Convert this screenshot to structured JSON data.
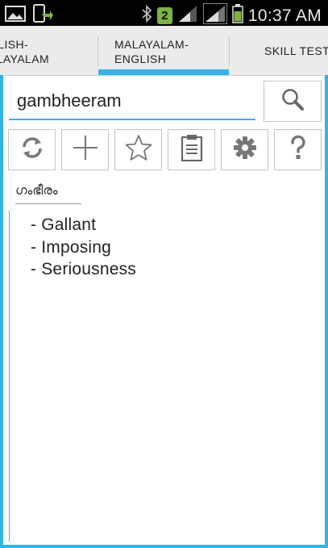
{
  "status_bar": {
    "time": "10:37 AM",
    "notification_count": "2",
    "icons": [
      "gallery-icon",
      "phone-transfer-icon",
      "bluetooth-icon",
      "signal-icon",
      "signal-icon",
      "battery-icon"
    ]
  },
  "tabs": [
    {
      "label": "GLISH-\nALAYALAM"
    },
    {
      "label": "MALAYALAM-\nENGLISH"
    },
    {
      "label": "SKILL TEST"
    }
  ],
  "active_tab": 1,
  "colors": {
    "accent": "#33b5e5",
    "badge": "#7cb342"
  },
  "search": {
    "value": "gambheeram",
    "button_icon": "search-icon"
  },
  "toolbar": {
    "buttons": [
      "refresh-icon",
      "add-icon",
      "star-icon",
      "clipboard-icon",
      "gear-icon",
      "help-icon"
    ]
  },
  "result": {
    "heading": "ഗംഭീരം",
    "meanings": [
      "- Gallant",
      "- Imposing",
      "- Seriousness"
    ]
  }
}
